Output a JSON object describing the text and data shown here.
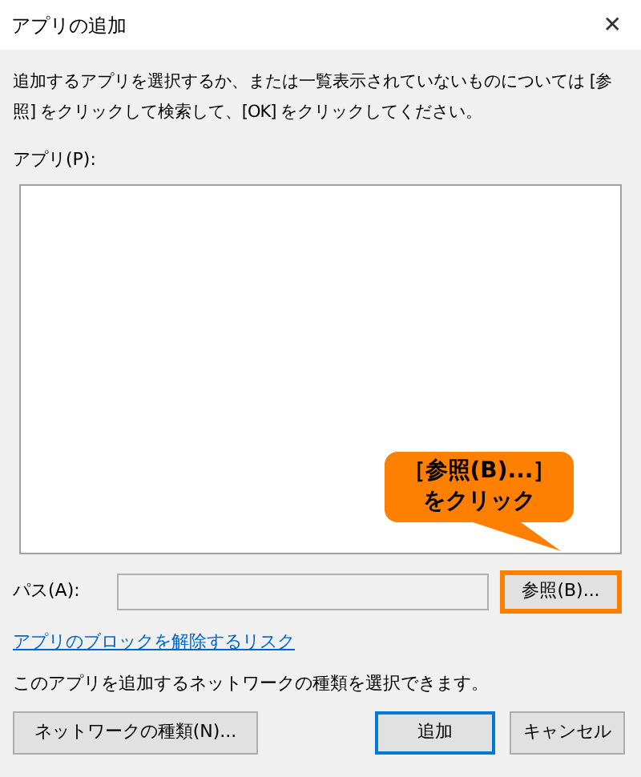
{
  "window": {
    "title": "アプリの追加",
    "close": "✕"
  },
  "description": "追加するアプリを選択するか、または一覧表示されていないものについては [参照] をクリックして検索して、[OK] をクリックしてください。",
  "apps_label": "アプリ(P):",
  "path": {
    "label": "パス(A):"
  },
  "browse_button": {
    "label": "参照(B)...",
    "highlighted": true
  },
  "callout": {
    "lines": [
      "［参照(B)...］",
      "をクリック"
    ]
  },
  "risk_link": "アプリのブロックを解除するリスク",
  "network_text": "このアプリを追加するネットワークの種類を選択できます。",
  "buttons": [
    {
      "label": "ネットワークの種類(N)...",
      "default": false
    },
    {
      "label": "追加",
      "default": true
    },
    {
      "label": "キャンセル",
      "default": false
    }
  ]
}
